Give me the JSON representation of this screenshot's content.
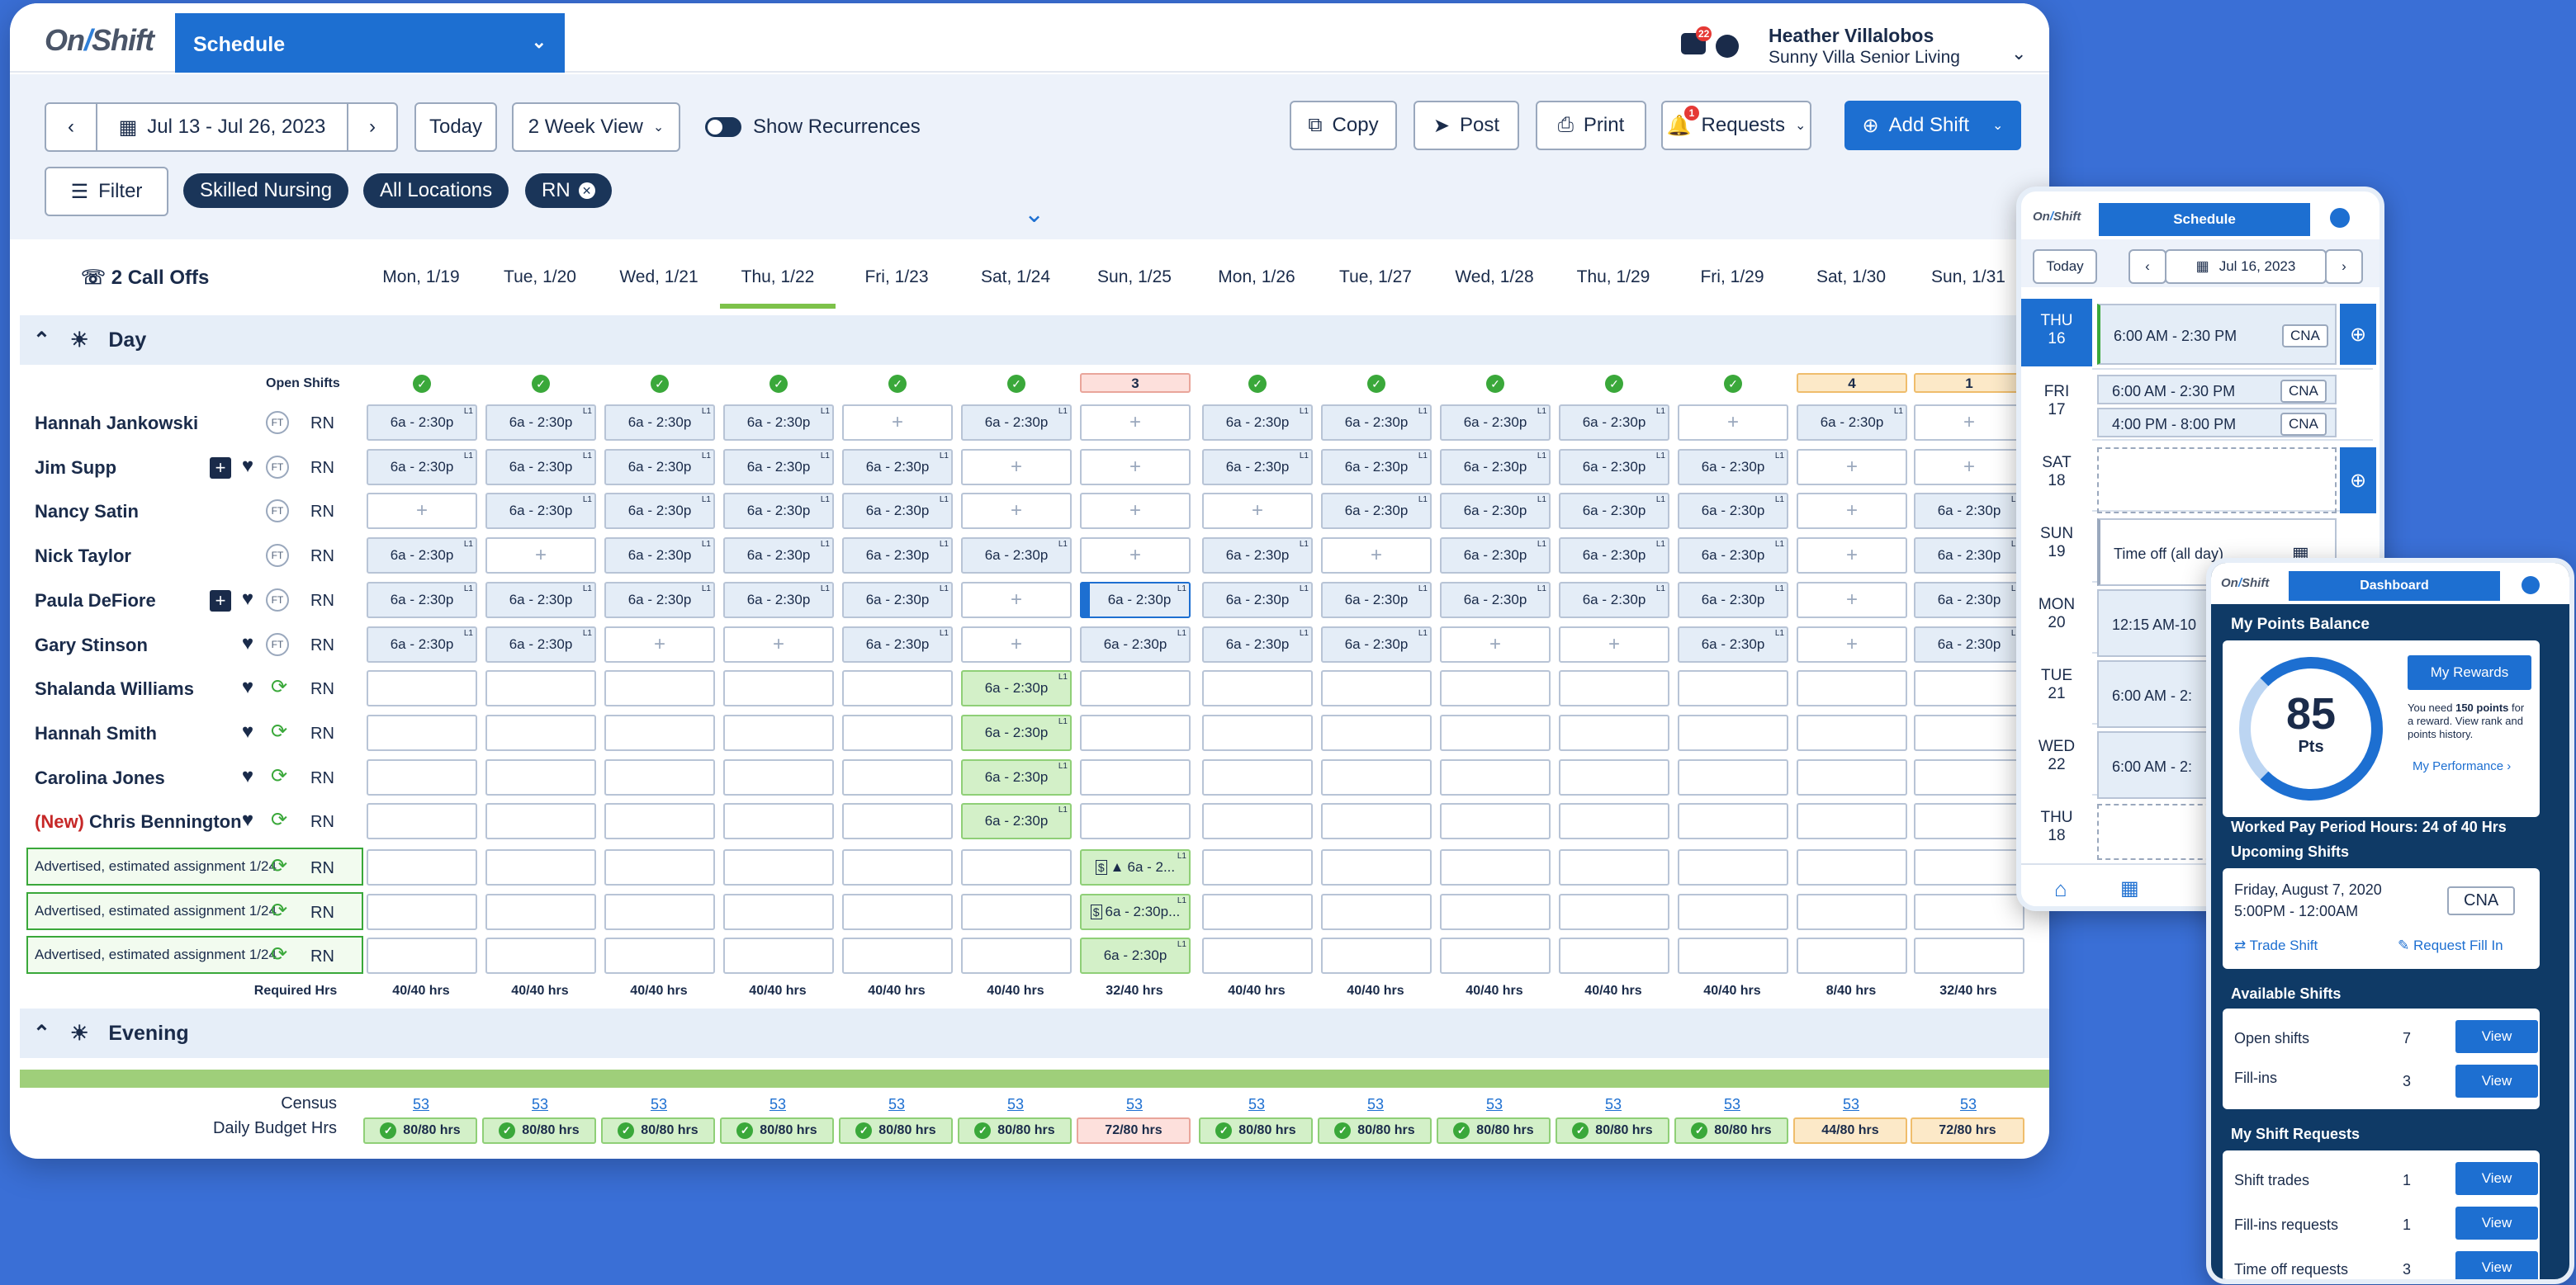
{
  "app": {
    "logo": "OnShift",
    "module": "Schedule"
  },
  "user": {
    "name": "Heather Villalobos",
    "org": "Sunny Villa Senior Living",
    "message_badge": "22"
  },
  "toolbar": {
    "date_range": "Jul 13 - Jul 26, 2023",
    "today": "Today",
    "view": "2 Week View",
    "recurrences": "Show Recurrences",
    "copy": "Copy",
    "post": "Post",
    "print": "Print",
    "requests": "Requests",
    "requests_badge": "1",
    "add_shift": "Add Shift",
    "filter": "Filter",
    "pills": [
      "Skilled Nursing",
      "All Locations",
      "RN"
    ]
  },
  "header": {
    "call_offs": "2 Call Offs",
    "days": [
      "Mon, 1/19",
      "Tue, 1/20",
      "Wed, 1/21",
      "Thu, 1/22",
      "Fri, 1/23",
      "Sat, 1/24",
      "Sun, 1/25",
      "Mon, 1/26",
      "Tue, 1/27",
      "Wed, 1/28",
      "Thu, 1/29",
      "Fri, 1/29",
      "Sat, 1/30",
      "Sun, 1/31"
    ]
  },
  "sections": {
    "day": "Day",
    "evening": "Evening",
    "open_shifts": "Open Shifts",
    "required": "Required Hrs"
  },
  "open_shifts": [
    "",
    "",
    "",
    "",
    "",
    "",
    "3",
    "",
    "",
    "",
    "",
    "",
    "4",
    "1"
  ],
  "staff": [
    {
      "name": "Hannah Jankowski",
      "role": "RN",
      "ft": "FT",
      "cells": [
        "s",
        "s",
        "s",
        "s",
        "a",
        "s",
        "a",
        "s",
        "s",
        "s",
        "s",
        "a",
        "s",
        "a"
      ]
    },
    {
      "name": "Jim Supp",
      "role": "RN",
      "ft": "FT",
      "cells": [
        "s",
        "s",
        "s",
        "s",
        "s",
        "a",
        "a",
        "s",
        "s",
        "s",
        "s",
        "s",
        "a",
        "a"
      ]
    },
    {
      "name": "Nancy Satin",
      "role": "RN",
      "ft": "FT",
      "cells": [
        "a",
        "s",
        "s",
        "s",
        "s",
        "a",
        "a",
        "a",
        "s",
        "s",
        "s",
        "s",
        "a",
        "s"
      ]
    },
    {
      "name": "Nick Taylor",
      "role": "RN",
      "ft": "FT",
      "cells": [
        "s",
        "a",
        "s",
        "s",
        "s",
        "s",
        "a",
        "s",
        "a",
        "s",
        "s",
        "s",
        "a",
        "s"
      ]
    },
    {
      "name": "Paula DeFiore",
      "role": "RN",
      "ft": "FT",
      "cells": [
        "s",
        "s",
        "s",
        "s",
        "s",
        "a",
        "s",
        "s",
        "s",
        "s",
        "s",
        "s",
        "a",
        "s"
      ]
    },
    {
      "name": "Gary Stinson",
      "role": "RN",
      "ft": "FT",
      "cells": [
        "s",
        "s",
        "a",
        "a",
        "s",
        "a",
        "s",
        "s",
        "s",
        "a",
        "a",
        "s",
        "a",
        "s"
      ]
    },
    {
      "name": "Shalanda Williams",
      "role": "RN",
      "cells": [
        "e",
        "e",
        "e",
        "e",
        "e",
        "g",
        "e",
        "e",
        "e",
        "e",
        "e",
        "e",
        "e",
        "e"
      ]
    },
    {
      "name": "Hannah Smith",
      "role": "RN",
      "cells": [
        "e",
        "e",
        "e",
        "e",
        "e",
        "g",
        "e",
        "e",
        "e",
        "e",
        "e",
        "e",
        "e",
        "e"
      ]
    },
    {
      "name": "Carolina Jones",
      "role": "RN",
      "cells": [
        "e",
        "e",
        "e",
        "e",
        "e",
        "g",
        "e",
        "e",
        "e",
        "e",
        "e",
        "e",
        "e",
        "e"
      ]
    },
    {
      "name": "Chris Bennington",
      "new": "(New)",
      "role": "RN",
      "cells": [
        "e",
        "e",
        "e",
        "e",
        "e",
        "g",
        "e",
        "e",
        "e",
        "e",
        "e",
        "e",
        "e",
        "e"
      ]
    }
  ],
  "shift_label": "6a - 2:30p",
  "l1": "L1",
  "advertised": {
    "label": "Advertised, estimated assignment 1/24",
    "role": "RN",
    "cells": [
      "6a - 2...",
      "6a - 2:30p...",
      "6a - 2:30p"
    ]
  },
  "required_hrs": [
    "40/40 hrs",
    "40/40 hrs",
    "40/40 hrs",
    "40/40 hrs",
    "40/40 hrs",
    "40/40 hrs",
    "32/40 hrs",
    "40/40 hrs",
    "40/40 hrs",
    "40/40 hrs",
    "40/40 hrs",
    "40/40 hrs",
    "8/40 hrs",
    "32/40 hrs"
  ],
  "census": {
    "label": "Census",
    "values": [
      "53",
      "53",
      "53",
      "53",
      "53",
      "53",
      "53",
      "53",
      "53",
      "53",
      "53",
      "53",
      "53",
      "53"
    ]
  },
  "budget": {
    "label": "Daily Budget Hrs",
    "values": [
      "80/80 hrs",
      "80/80 hrs",
      "80/80 hrs",
      "80/80 hrs",
      "80/80 hrs",
      "80/80 hrs",
      "72/80 hrs",
      "80/80 hrs",
      "80/80 hrs",
      "80/80 hrs",
      "80/80 hrs",
      "80/80 hrs",
      "44/80 hrs",
      "72/80 hrs"
    ]
  },
  "phone1": {
    "logo": "OnShift",
    "module": "Schedule",
    "today": "Today",
    "date": "Jul 16, 2023",
    "days": [
      {
        "d": "THU",
        "n": "16"
      },
      {
        "d": "FRI",
        "n": "17"
      },
      {
        "d": "SAT",
        "n": "18"
      },
      {
        "d": "SUN",
        "n": "19"
      },
      {
        "d": "MON",
        "n": "20"
      },
      {
        "d": "TUE",
        "n": "21"
      },
      {
        "d": "WED",
        "n": "22"
      },
      {
        "d": "THU",
        "n": "18"
      }
    ],
    "shifts": {
      "thu": "6:00 AM - 2:30 PM",
      "fri1": "6:00 AM - 2:30 PM",
      "fri2": "4:00 PM - 8:00 PM",
      "sun": "Time off (all day)",
      "mon": "12:15 AM-10",
      "tue": "6:00 AM - 2:",
      "wed": "6:00 AM - 2:"
    },
    "tag": "CNA"
  },
  "phone2": {
    "logo": "OnShift",
    "module": "Dashboard",
    "points_title": "My Points Balance",
    "points": "85",
    "pts": "Pts",
    "rewards_btn": "My Rewards",
    "need_pre": "You need ",
    "need_pts": "150 points",
    "need_post": " for a reward. View rank and points history.",
    "performance": "My Performance ›",
    "worked": "Worked Pay Period Hours: 24 of 40 Hrs",
    "upcoming": "Upcoming Shifts",
    "shift_date": "Friday, August 7, 2020",
    "shift_time": "5:00PM - 12:00AM",
    "shift_tag": "CNA",
    "trade": "Trade Shift",
    "fill": "Request Fill In",
    "available": "Available Shifts",
    "open": "Open shifts",
    "open_n": "7",
    "fillins": "Fill-ins",
    "fillins_n": "3",
    "requests": "My Shift Requests",
    "trades": "Shift trades",
    "trades_n": "1",
    "fillreq": "Fill-ins requests",
    "fillreq_n": "1",
    "timeoff": "Time off requests",
    "timeoff_n": "3",
    "view": "View"
  },
  "colors": {
    "brand": "#1d6fd1",
    "navy": "#1a3559",
    "green": "#3aa83a",
    "background": "#3a6fd6"
  }
}
